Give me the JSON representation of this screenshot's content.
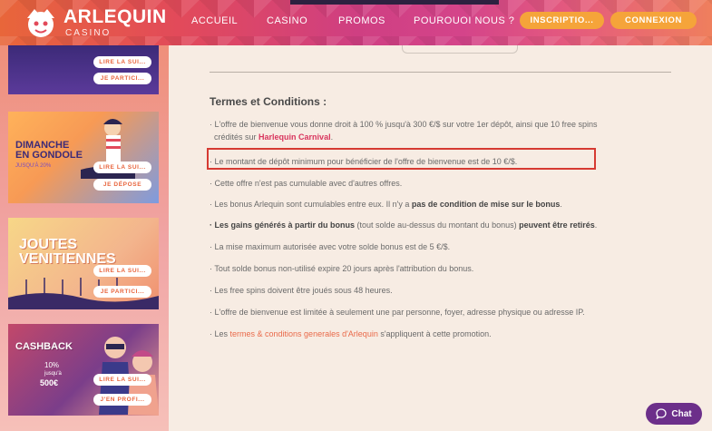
{
  "header": {
    "brand": "ARLEQUIN",
    "brand_sub": "CASINO",
    "nav": [
      "ACCUEIL",
      "CASINO",
      "PROMOS",
      "POUROUOI NOUS ?"
    ],
    "inscription_label": "INSCRIPTIO...",
    "connexion_label": "CONNEXION"
  },
  "sidebar": {
    "cards": [
      {
        "btn1": "LIRE LA SUI...",
        "btn2": "JE PARTICI..."
      },
      {
        "title_line1": "DIMANCHE",
        "title_line2": "EN GONDOLE",
        "sub": "JUSQU'À 20%",
        "btn1": "LIRE LA SUI...",
        "btn2": "JE DÉPOSE"
      },
      {
        "title_line1": "JOUTES",
        "title_line2": "VENITIENNES",
        "btn1": "LIRE LA SUI...",
        "btn2": "JE PARTICI..."
      },
      {
        "title": "CASHBACK",
        "sub1": "10%",
        "sub2": "jusqu'à",
        "sub3": "500€",
        "btn1": "LIRE LA SUI...",
        "btn2": "J'EN PROFI..."
      }
    ]
  },
  "main": {
    "heading": "Termes et Conditions :",
    "items": [
      {
        "pre": "· L'offre de bienvenue vous donne droit à 100 % jusqu'à 300 €/$ sur votre 1er dépôt, ainsi que 10 free spins",
        "line2_pre": "crédités sur ",
        "link": "Harlequin Carnival",
        "line2_post": "."
      },
      {
        "text": "· Le montant de dépôt minimum pour bénéficier de l'offre de bienvenue est de 10 €/$."
      },
      {
        "text": "· Cette offre n'est pas cumulable avec d'autres offres."
      },
      {
        "pre": "· Les bonus Arlequin sont cumulables entre eux. Il n'y a ",
        "bold": "pas de condition de mise sur le bonus",
        "post": "."
      },
      {
        "bold1": "· Les gains générés à partir du bonus",
        "mid": " (tout solde au-dessus du montant du bonus) ",
        "bold2": "peuvent être retirés",
        "post": "."
      },
      {
        "text": "· La mise maximum autorisée avec votre solde bonus est de 5 €/$."
      },
      {
        "text": "· Tout solde bonus non-utilisé expire 20 jours après l'attribution du bonus."
      },
      {
        "text": "· Les free spins doivent être joués sous 48 heures."
      },
      {
        "text": "· L'offre de bienvenue est limitée à seulement une par personne, foyer, adresse physique ou adresse IP."
      },
      {
        "pre": "· Les ",
        "link": "termes & conditions generales d'Arlequin",
        "post": " s'appliquent à cette promotion."
      }
    ]
  },
  "chat": {
    "label": "Chat"
  },
  "colors": {
    "accent": "#f5a43a",
    "link": "#d9365e",
    "highlight": "#d63a32",
    "chat": "#6c2f8a"
  }
}
